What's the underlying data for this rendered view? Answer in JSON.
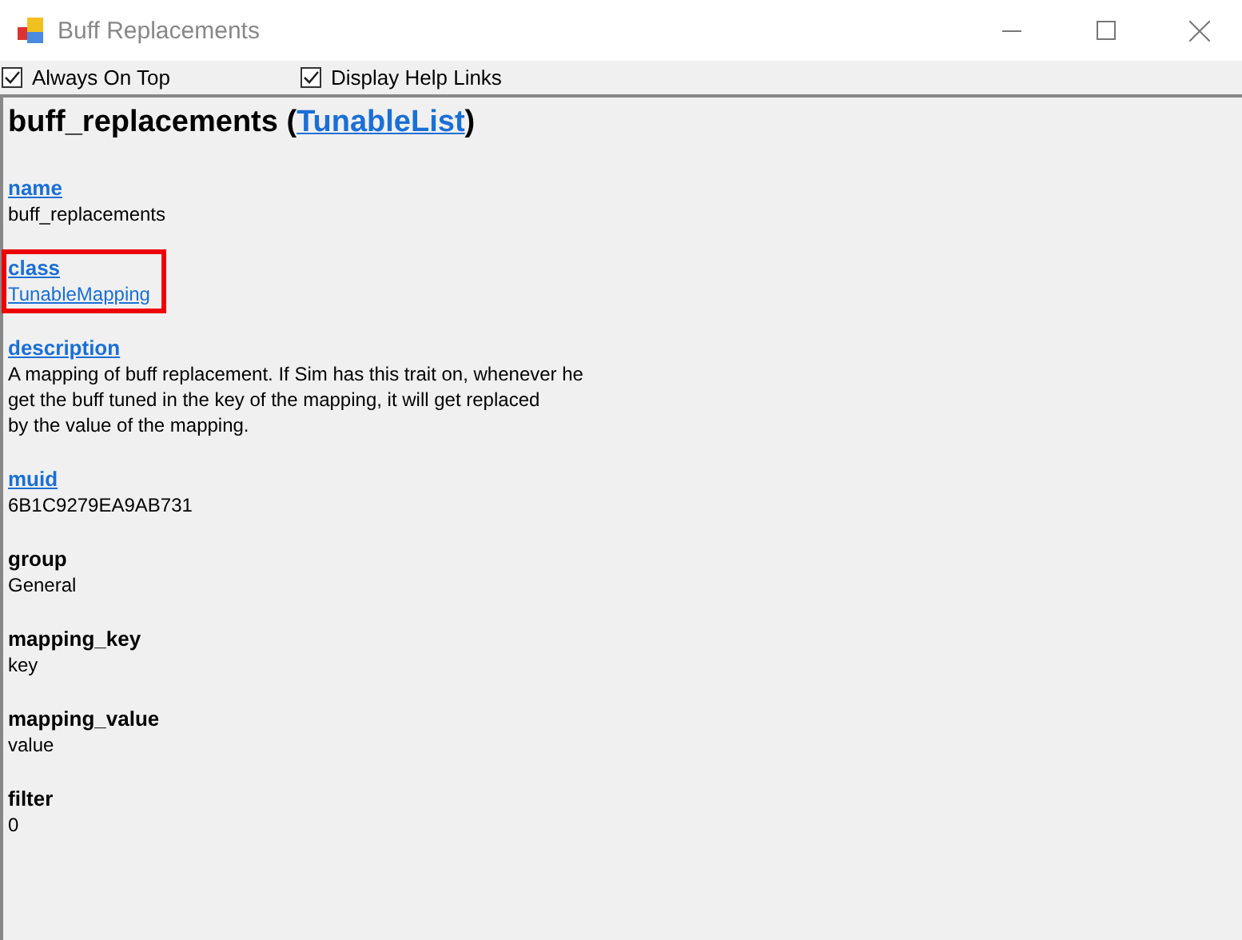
{
  "window": {
    "title": "Buff Replacements"
  },
  "toolbar": [
    {
      "label": "Always On Top",
      "checked": true
    },
    {
      "label": "Display Help Links",
      "checked": true
    }
  ],
  "heading": {
    "name": "buff_replacements",
    "open": "(",
    "type": "TunableList",
    "close": ")"
  },
  "fields": [
    {
      "label": "name",
      "label_link": true,
      "lines": [
        "buff_replacements"
      ],
      "value_link": false,
      "highlighted": false
    },
    {
      "label": "class",
      "label_link": true,
      "lines": [
        "TunableMapping"
      ],
      "value_link": true,
      "highlighted": true
    },
    {
      "label": "description",
      "label_link": true,
      "lines": [
        "A mapping of buff replacement. If Sim has this trait on, whenever he",
        "get the buff tuned in the key of the mapping, it will get replaced",
        "by the value of the mapping."
      ],
      "value_link": false,
      "highlighted": false
    },
    {
      "label": "muid",
      "label_link": true,
      "lines": [
        "6B1C9279EA9AB731"
      ],
      "value_link": false,
      "highlighted": false
    },
    {
      "label": "group",
      "label_link": false,
      "lines": [
        "General"
      ],
      "value_link": false,
      "highlighted": false
    },
    {
      "label": "mapping_key",
      "label_link": false,
      "lines": [
        "key"
      ],
      "value_link": false,
      "highlighted": false
    },
    {
      "label": "mapping_value",
      "label_link": false,
      "lines": [
        "value"
      ],
      "value_link": false,
      "highlighted": false
    },
    {
      "label": "filter",
      "label_link": false,
      "lines": [
        "0"
      ],
      "value_link": false,
      "highlighted": false
    }
  ]
}
